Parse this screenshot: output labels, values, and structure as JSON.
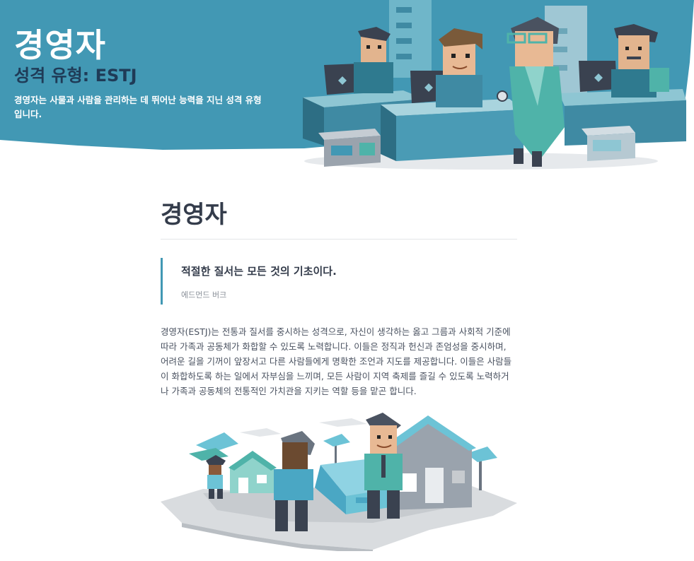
{
  "header": {
    "title": "경영자",
    "subtitle": "성격 유형: ESTJ",
    "description": "경영자는 사물과 사람을 관리하는 데 뛰어난 능력을 지닌 성격 유형입니다."
  },
  "article": {
    "title": "경영자",
    "quote": "적절한 질서는 모든 것의 기초이다.",
    "quote_author": "에드먼드 버크",
    "paragraph": "경영자(ESTJ)는 전통과 질서를 중시하는 성격으로, 자신이 생각하는 옳고 그름과 사회적 기준에 따라 가족과 공동체가 화합할 수 있도록 노력합니다. 이들은 정직과 헌신과 존엄성을 중시하며, 어려운 길을 기꺼이 앞장서고 다른 사람들에게 명확한 조언과 지도를 제공합니다. 이들은 사람들이 화합하도록 하는 일에서 자부심을 느끼며, 모든 사람이 지역 축제를 즐길 수 있도록 노력하거나 가족과 공동체의 전통적인 가치관을 지키는 역할 등을 맡곤 합니다."
  },
  "colors": {
    "hero_bg": "#4298b4",
    "subtitle": "#1f3b57",
    "accent": "#4298b4"
  },
  "icons": {
    "hero_illustration": "office-workers-illustration",
    "story_illustration": "neighborhood-moving-illustration"
  }
}
